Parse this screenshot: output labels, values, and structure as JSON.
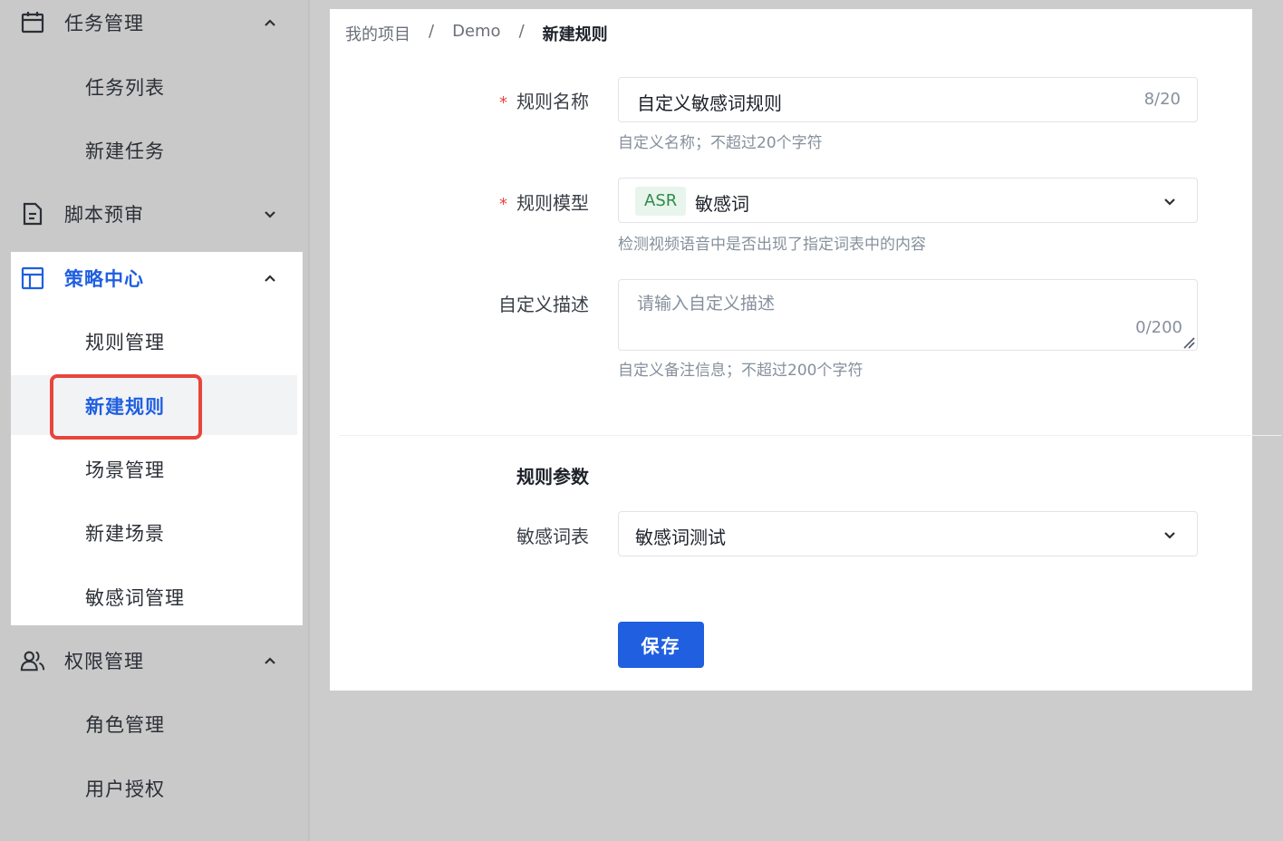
{
  "sidebar": {
    "groups": [
      {
        "label": "任务管理",
        "icon": "calendar-icon",
        "expanded": true,
        "items": [
          "任务列表",
          "新建任务"
        ]
      },
      {
        "label": "脚本预审",
        "icon": "document-icon",
        "expanded": false,
        "items": []
      },
      {
        "label": "策略中心",
        "icon": "layout-icon",
        "expanded": true,
        "active": true,
        "items": [
          "规则管理",
          "新建规则",
          "场景管理",
          "新建场景",
          "敏感词管理"
        ]
      },
      {
        "label": "权限管理",
        "icon": "users-icon",
        "expanded": true,
        "items": [
          "角色管理",
          "用户授权"
        ]
      }
    ]
  },
  "breadcrumb": {
    "items": [
      "我的项目",
      "Demo",
      "新建规则"
    ],
    "separator": "/"
  },
  "form": {
    "rule_name": {
      "label": "规则名称",
      "value": "自定义敏感词规则",
      "counter": "8/20",
      "help": "自定义名称；不超过20个字符"
    },
    "rule_model": {
      "label": "规则模型",
      "tag": "ASR",
      "value": "敏感词",
      "help": "检测视频语音中是否出现了指定词表中的内容"
    },
    "description": {
      "label": "自定义描述",
      "placeholder": "请输入自定义描述",
      "counter": "0/200",
      "help": "自定义备注信息；不超过200个字符"
    },
    "params_title": "规则参数",
    "word_list": {
      "label": "敏感词表",
      "value": "敏感词测试"
    },
    "save_label": "保存",
    "required_mark": "*"
  },
  "colors": {
    "accent": "#1f5fe0",
    "highlight": "#e8453c",
    "tag_bg": "#e8f5ec",
    "tag_text": "#2f8a4a"
  }
}
